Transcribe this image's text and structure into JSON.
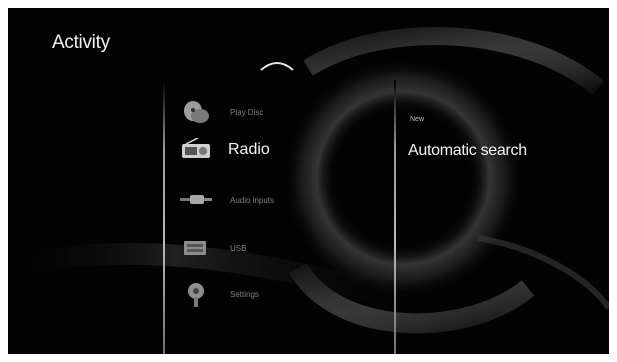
{
  "screen": {
    "title": "Activity"
  },
  "menu": {
    "items": [
      {
        "label": "Play Disc",
        "icon": "disc-icon",
        "selected": false
      },
      {
        "label": "Radio",
        "icon": "radio-icon",
        "selected": true
      },
      {
        "label": "Audio inputs",
        "icon": "audio-input-icon",
        "selected": false
      },
      {
        "label": "USB",
        "icon": "usb-icon",
        "selected": false
      },
      {
        "label": "Settings",
        "icon": "settings-icon",
        "selected": false
      }
    ]
  },
  "submenu": {
    "caption": "New",
    "items": [
      {
        "label": "Automatic search"
      }
    ]
  },
  "colors": {
    "background": "#030303",
    "text_primary": "#f5f5f5",
    "text_dim": "#7f7f7f"
  }
}
